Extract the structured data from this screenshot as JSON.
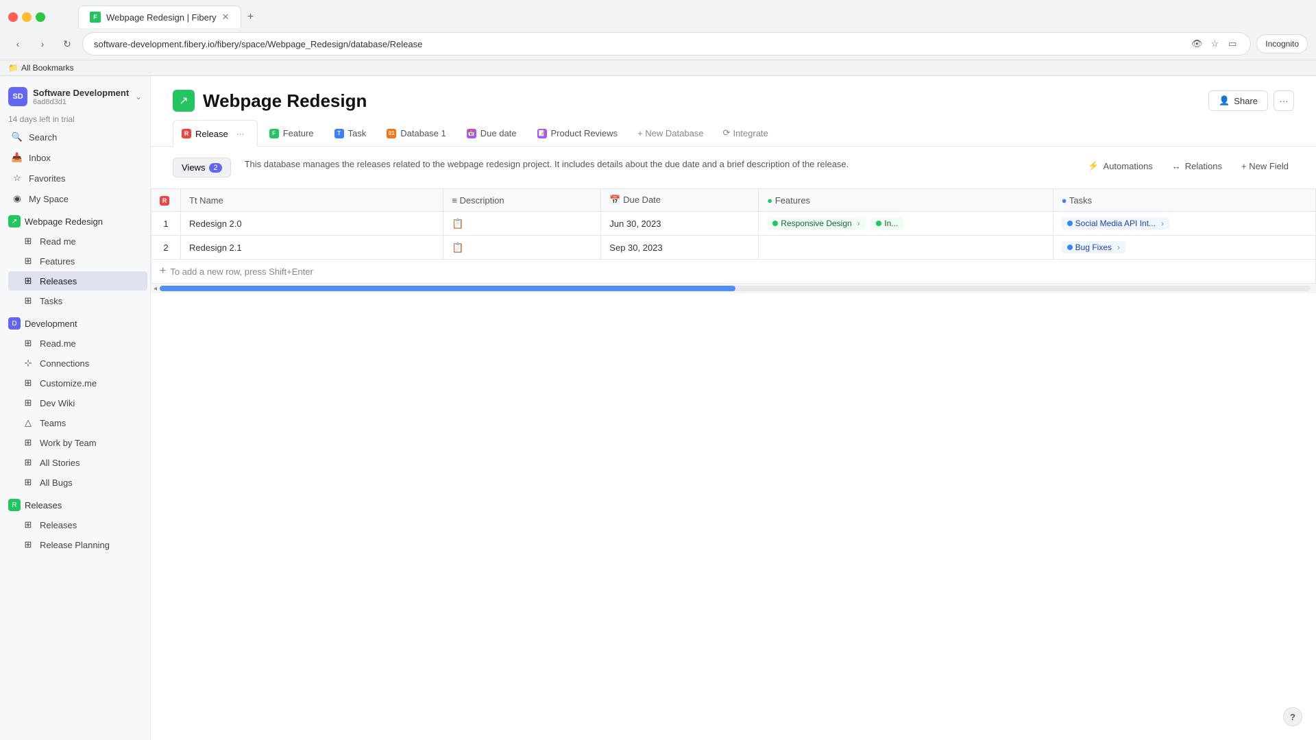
{
  "browser": {
    "tab_favicon": "F",
    "tab_title": "Webpage Redesign | Fibery",
    "url": "software-development.fibery.io/fibery/space/Webpage_Redesign/database/Release",
    "incognito_label": "Incognito",
    "bookmarks_label": "All Bookmarks"
  },
  "workspace": {
    "name": "Software Development",
    "id": "6ad8d3d1",
    "avatar_text": "SD",
    "trial_text": "14 days left in trial"
  },
  "sidebar": {
    "search_label": "Search",
    "inbox_label": "Inbox",
    "favorites_label": "Favorites",
    "myspace_label": "My Space",
    "sections": [
      {
        "name": "Webpage Redesign",
        "items": [
          {
            "label": "Read me",
            "icon": "grid"
          },
          {
            "label": "Features",
            "icon": "grid"
          },
          {
            "label": "Releases",
            "icon": "grid",
            "active": true
          },
          {
            "label": "Tasks",
            "icon": "grid"
          }
        ]
      },
      {
        "name": "Development",
        "items": [
          {
            "label": "Read.me",
            "icon": "grid"
          },
          {
            "label": "Connections",
            "icon": "nodes"
          },
          {
            "label": "Customize.me",
            "icon": "grid"
          },
          {
            "label": "Dev Wiki",
            "icon": "grid"
          },
          {
            "label": "Teams",
            "icon": "triangle"
          },
          {
            "label": "Work by Team",
            "icon": "grid"
          },
          {
            "label": "All Stories",
            "icon": "grid"
          },
          {
            "label": "All Bugs",
            "icon": "grid"
          }
        ]
      },
      {
        "name": "Releases",
        "items": [
          {
            "label": "Releases",
            "icon": "grid"
          },
          {
            "label": "Release Planning",
            "icon": "grid"
          }
        ]
      }
    ]
  },
  "page": {
    "icon": "↗",
    "title": "Webpage Redesign",
    "share_label": "Share",
    "more_label": "···"
  },
  "tabs": [
    {
      "label": "Release",
      "color": "red",
      "active": true,
      "has_more": true
    },
    {
      "label": "Feature",
      "color": "green"
    },
    {
      "label": "Task",
      "color": "blue"
    },
    {
      "label": "Database 1",
      "color": "orange",
      "number": "01"
    },
    {
      "label": "Due date",
      "color": "purple"
    },
    {
      "label": "Product Reviews",
      "color": "purple"
    }
  ],
  "toolbar": {
    "new_database_label": "+ New Database",
    "integrate_label": "Integrate",
    "views_label": "Views",
    "views_count": "2",
    "automations_label": "Automations",
    "relations_label": "Relations",
    "new_field_label": "+ New Field"
  },
  "description": "This database manages the releases related to the webpage redesign project. It includes details about the due date and a brief description of the release.",
  "table": {
    "columns": [
      {
        "label": "Name",
        "icon": "Tt"
      },
      {
        "label": "Description",
        "icon": "≡"
      },
      {
        "label": "Due Date",
        "icon": "📅"
      },
      {
        "label": "Features",
        "icon": "●"
      },
      {
        "label": "Tasks",
        "icon": "●"
      }
    ],
    "rows": [
      {
        "num": "1",
        "name": "Redesign 2.0",
        "has_desc": true,
        "due_date": "Jun 30, 2023",
        "features": [
          {
            "label": "Responsive Design",
            "has_more": true
          },
          {
            "label": "In...",
            "has_more": false
          }
        ],
        "tasks": [
          {
            "label": "Social Media API Int...",
            "has_more": true
          }
        ]
      },
      {
        "num": "2",
        "name": "Redesign 2.1",
        "has_desc": true,
        "due_date": "Sep 30, 2023",
        "features": [],
        "tasks": [
          {
            "label": "Bug Fixes",
            "has_more": true
          }
        ]
      }
    ],
    "add_row_hint": "To add a new row, press Shift+Enter"
  },
  "help_label": "?"
}
